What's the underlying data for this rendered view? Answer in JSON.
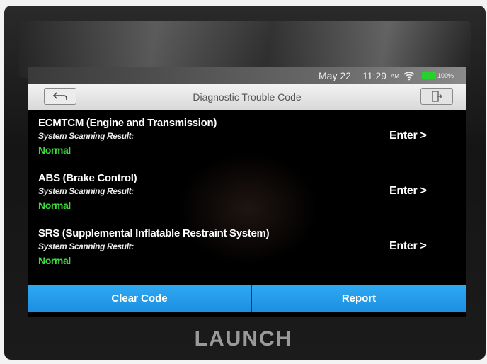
{
  "status_bar": {
    "date": "May 22",
    "time": "11:29",
    "ampm": "AM",
    "battery": "100%",
    "icons": [
      "wifi-icon",
      "battery-icon"
    ]
  },
  "title_bar": {
    "title": "Diagnostic Trouble Code",
    "back_icon": "back-arrow-icon",
    "exit_icon": "exit-icon"
  },
  "systems": [
    {
      "name": "ECMTCM (Engine and Transmission)",
      "subtitle": "System Scanning Result:",
      "status": "Normal",
      "enter": "Enter >"
    },
    {
      "name": "ABS (Brake Control)",
      "subtitle": "System Scanning Result:",
      "status": "Normal",
      "enter": "Enter >"
    },
    {
      "name": "SRS (Supplemental Inflatable Restraint System)",
      "subtitle": "System Scanning Result:",
      "status": "Normal",
      "enter": "Enter >"
    }
  ],
  "buttons": {
    "clear_code": "Clear Code",
    "report": "Report"
  },
  "brand": "LAUNCH",
  "colors": {
    "accent": "#1e96e6",
    "status_ok": "#3ddc3d",
    "battery": "#26d12c"
  }
}
